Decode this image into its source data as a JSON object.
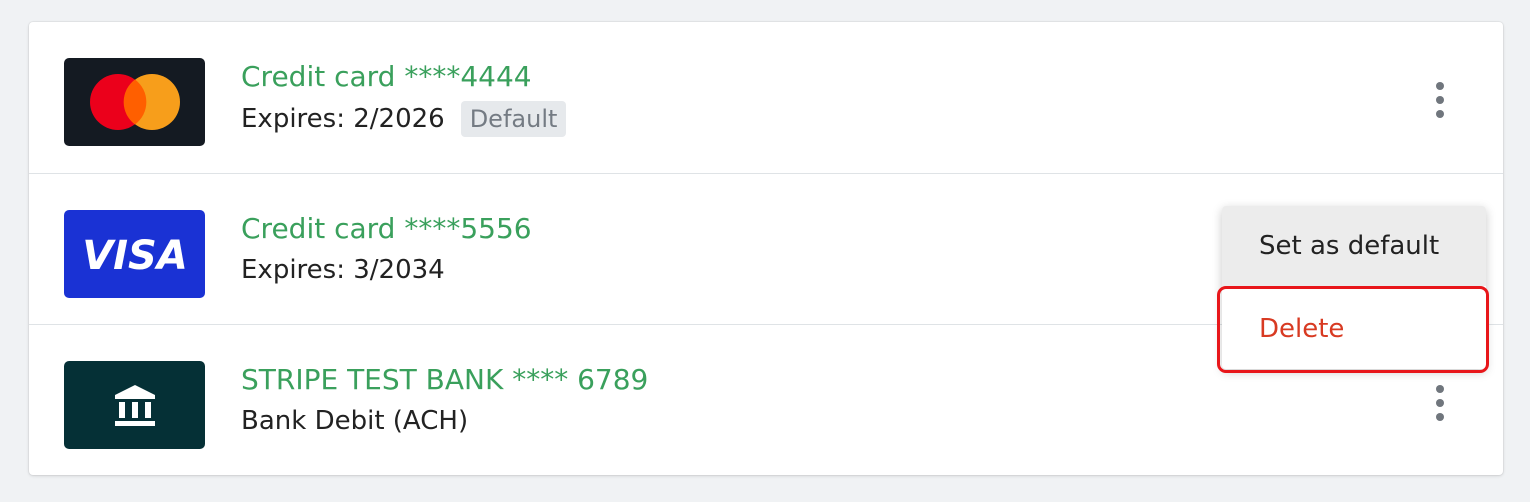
{
  "payment_methods": [
    {
      "brand": "mastercard",
      "icon": "mastercard-logo-icon",
      "title": "Credit card ****4444",
      "subtitle": "Expires: 2/2026",
      "badge": "Default"
    },
    {
      "brand": "visa",
      "icon": "visa-logo-icon",
      "logo_text": "VISA",
      "title": "Credit card ****5556",
      "subtitle": "Expires: 3/2034"
    },
    {
      "brand": "bank",
      "icon": "bank-icon",
      "title": "STRIPE TEST BANK **** 6789",
      "subtitle": "Bank Debit (ACH)"
    }
  ],
  "context_menu": {
    "items": [
      "Set as default",
      "Delete"
    ]
  },
  "colors": {
    "title_green": "#3aa05c",
    "delete_red": "#d83a22",
    "highlight_red": "#e8161a",
    "visa_blue": "#1a32d4",
    "bank_dark": "#053036",
    "mastercard_bg": "#141a22"
  }
}
